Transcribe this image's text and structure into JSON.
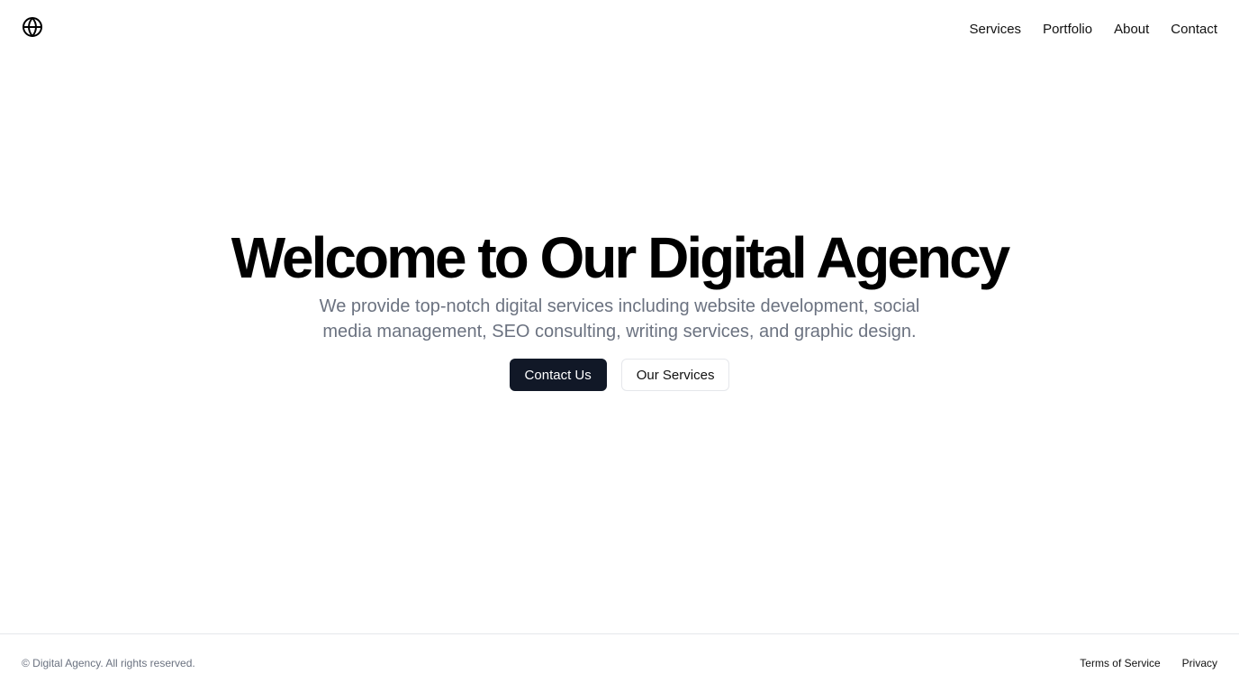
{
  "header": {
    "logo_icon": "globe-icon",
    "nav": [
      {
        "label": "Services"
      },
      {
        "label": "Portfolio"
      },
      {
        "label": "About"
      },
      {
        "label": "Contact"
      }
    ]
  },
  "hero": {
    "title": "Welcome to Our Digital Agency",
    "subtitle": "We provide top-notch digital services including website development, social media management, SEO consulting, writing services, and graphic design.",
    "primary_button": "Contact Us",
    "secondary_button": "Our Services"
  },
  "footer": {
    "copyright": "© Digital Agency. All rights reserved.",
    "links": [
      {
        "label": "Terms of Service"
      },
      {
        "label": "Privacy"
      }
    ]
  },
  "colors": {
    "primary_button_bg": "#111827",
    "subtitle_text": "#6b7280",
    "border": "#e5e7eb"
  }
}
